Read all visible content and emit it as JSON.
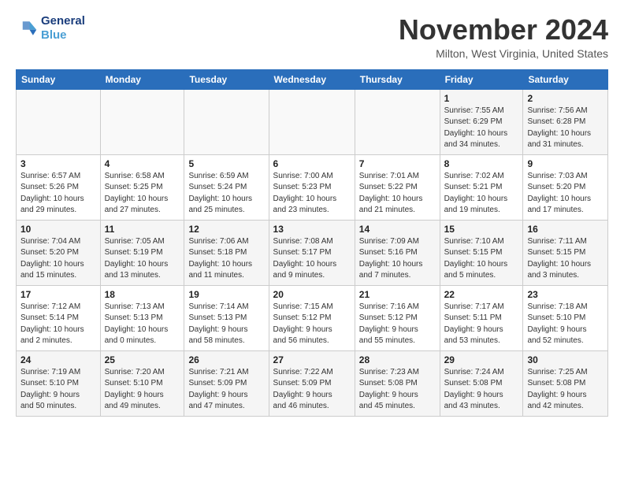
{
  "logo": {
    "text_general": "General",
    "text_blue": "Blue"
  },
  "header": {
    "month": "November 2024",
    "location": "Milton, West Virginia, United States"
  },
  "days_header": [
    "Sunday",
    "Monday",
    "Tuesday",
    "Wednesday",
    "Thursday",
    "Friday",
    "Saturday"
  ],
  "weeks": [
    [
      {
        "day": "",
        "info": ""
      },
      {
        "day": "",
        "info": ""
      },
      {
        "day": "",
        "info": ""
      },
      {
        "day": "",
        "info": ""
      },
      {
        "day": "",
        "info": ""
      },
      {
        "day": "1",
        "info": "Sunrise: 7:55 AM\nSunset: 6:29 PM\nDaylight: 10 hours\nand 34 minutes."
      },
      {
        "day": "2",
        "info": "Sunrise: 7:56 AM\nSunset: 6:28 PM\nDaylight: 10 hours\nand 31 minutes."
      }
    ],
    [
      {
        "day": "3",
        "info": "Sunrise: 6:57 AM\nSunset: 5:26 PM\nDaylight: 10 hours\nand 29 minutes."
      },
      {
        "day": "4",
        "info": "Sunrise: 6:58 AM\nSunset: 5:25 PM\nDaylight: 10 hours\nand 27 minutes."
      },
      {
        "day": "5",
        "info": "Sunrise: 6:59 AM\nSunset: 5:24 PM\nDaylight: 10 hours\nand 25 minutes."
      },
      {
        "day": "6",
        "info": "Sunrise: 7:00 AM\nSunset: 5:23 PM\nDaylight: 10 hours\nand 23 minutes."
      },
      {
        "day": "7",
        "info": "Sunrise: 7:01 AM\nSunset: 5:22 PM\nDaylight: 10 hours\nand 21 minutes."
      },
      {
        "day": "8",
        "info": "Sunrise: 7:02 AM\nSunset: 5:21 PM\nDaylight: 10 hours\nand 19 minutes."
      },
      {
        "day": "9",
        "info": "Sunrise: 7:03 AM\nSunset: 5:20 PM\nDaylight: 10 hours\nand 17 minutes."
      }
    ],
    [
      {
        "day": "10",
        "info": "Sunrise: 7:04 AM\nSunset: 5:20 PM\nDaylight: 10 hours\nand 15 minutes."
      },
      {
        "day": "11",
        "info": "Sunrise: 7:05 AM\nSunset: 5:19 PM\nDaylight: 10 hours\nand 13 minutes."
      },
      {
        "day": "12",
        "info": "Sunrise: 7:06 AM\nSunset: 5:18 PM\nDaylight: 10 hours\nand 11 minutes."
      },
      {
        "day": "13",
        "info": "Sunrise: 7:08 AM\nSunset: 5:17 PM\nDaylight: 10 hours\nand 9 minutes."
      },
      {
        "day": "14",
        "info": "Sunrise: 7:09 AM\nSunset: 5:16 PM\nDaylight: 10 hours\nand 7 minutes."
      },
      {
        "day": "15",
        "info": "Sunrise: 7:10 AM\nSunset: 5:15 PM\nDaylight: 10 hours\nand 5 minutes."
      },
      {
        "day": "16",
        "info": "Sunrise: 7:11 AM\nSunset: 5:15 PM\nDaylight: 10 hours\nand 3 minutes."
      }
    ],
    [
      {
        "day": "17",
        "info": "Sunrise: 7:12 AM\nSunset: 5:14 PM\nDaylight: 10 hours\nand 2 minutes."
      },
      {
        "day": "18",
        "info": "Sunrise: 7:13 AM\nSunset: 5:13 PM\nDaylight: 10 hours\nand 0 minutes."
      },
      {
        "day": "19",
        "info": "Sunrise: 7:14 AM\nSunset: 5:13 PM\nDaylight: 9 hours\nand 58 minutes."
      },
      {
        "day": "20",
        "info": "Sunrise: 7:15 AM\nSunset: 5:12 PM\nDaylight: 9 hours\nand 56 minutes."
      },
      {
        "day": "21",
        "info": "Sunrise: 7:16 AM\nSunset: 5:12 PM\nDaylight: 9 hours\nand 55 minutes."
      },
      {
        "day": "22",
        "info": "Sunrise: 7:17 AM\nSunset: 5:11 PM\nDaylight: 9 hours\nand 53 minutes."
      },
      {
        "day": "23",
        "info": "Sunrise: 7:18 AM\nSunset: 5:10 PM\nDaylight: 9 hours\nand 52 minutes."
      }
    ],
    [
      {
        "day": "24",
        "info": "Sunrise: 7:19 AM\nSunset: 5:10 PM\nDaylight: 9 hours\nand 50 minutes."
      },
      {
        "day": "25",
        "info": "Sunrise: 7:20 AM\nSunset: 5:10 PM\nDaylight: 9 hours\nand 49 minutes."
      },
      {
        "day": "26",
        "info": "Sunrise: 7:21 AM\nSunset: 5:09 PM\nDaylight: 9 hours\nand 47 minutes."
      },
      {
        "day": "27",
        "info": "Sunrise: 7:22 AM\nSunset: 5:09 PM\nDaylight: 9 hours\nand 46 minutes."
      },
      {
        "day": "28",
        "info": "Sunrise: 7:23 AM\nSunset: 5:08 PM\nDaylight: 9 hours\nand 45 minutes."
      },
      {
        "day": "29",
        "info": "Sunrise: 7:24 AM\nSunset: 5:08 PM\nDaylight: 9 hours\nand 43 minutes."
      },
      {
        "day": "30",
        "info": "Sunrise: 7:25 AM\nSunset: 5:08 PM\nDaylight: 9 hours\nand 42 minutes."
      }
    ]
  ]
}
